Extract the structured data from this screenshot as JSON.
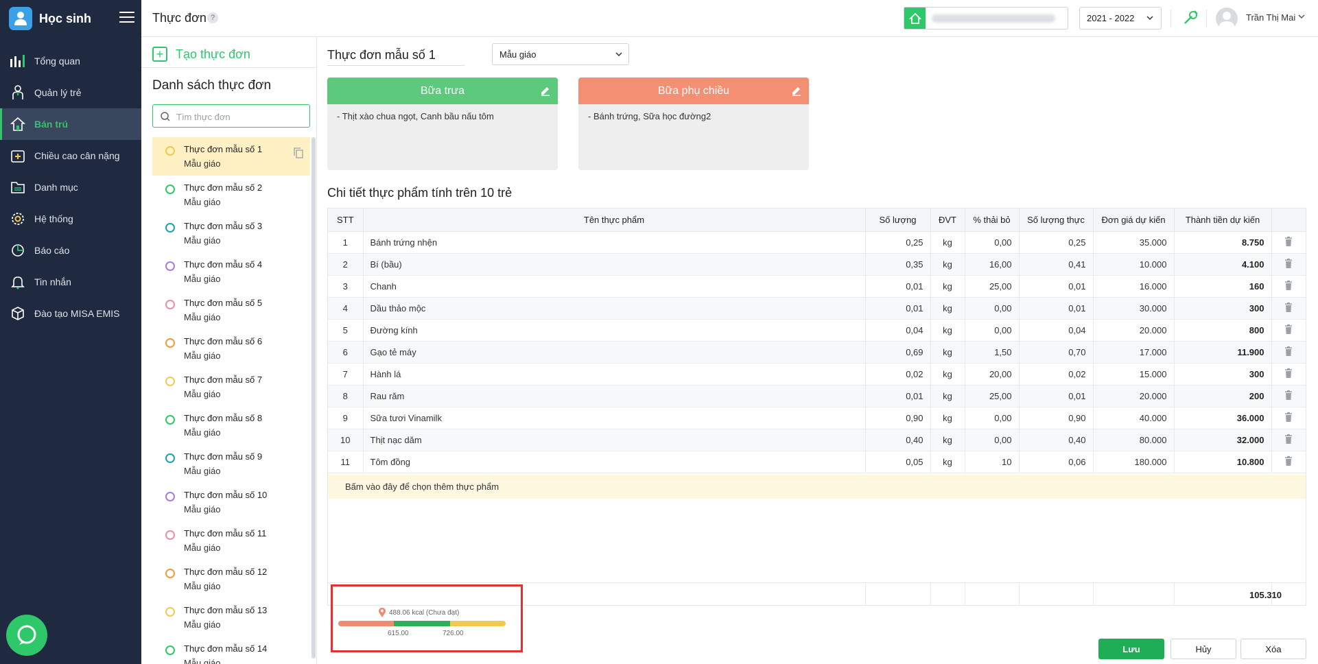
{
  "app": {
    "title": "Học sinh",
    "page_title": "Thực đơn",
    "help": "?"
  },
  "sidebar": {
    "items": [
      {
        "label": "Tổng quan",
        "icon": "chart-icon"
      },
      {
        "label": "Quản lý trẻ",
        "icon": "child-icon"
      },
      {
        "label": "Bán trú",
        "icon": "home-icon"
      },
      {
        "label": "Chiều cao cân nặng",
        "icon": "medical-icon"
      },
      {
        "label": "Danh mục",
        "icon": "folder-icon"
      },
      {
        "label": "Hệ thống",
        "icon": "gear-icon"
      },
      {
        "label": "Báo cáo",
        "icon": "pie-chart-icon"
      },
      {
        "label": "Tin nhắn",
        "icon": "bell-icon"
      },
      {
        "label": "Đào tạo MISA EMIS",
        "icon": "cube-icon"
      }
    ],
    "active_index": 2
  },
  "topbar": {
    "year": "2021 - 2022",
    "user": "Trần Thị Mai"
  },
  "left": {
    "create_label": "Tạo thực đơn",
    "list_title": "Danh sách thực đơn",
    "search_placeholder": "Tìm thực đơn",
    "menus": [
      {
        "name": "Thực đơn mẫu số 1",
        "sub": "Mẫu giáo",
        "color": "#f2c94c"
      },
      {
        "name": "Thực đơn mẫu số 2",
        "sub": "Mẫu giáo",
        "color": "#2ec86a"
      },
      {
        "name": "Thực đơn mẫu số 3",
        "sub": "Mẫu giáo",
        "color": "#17a7a0"
      },
      {
        "name": "Thực đơn mẫu số 4",
        "sub": "Mẫu giáo",
        "color": "#a57ed8"
      },
      {
        "name": "Thực đơn mẫu số 5",
        "sub": "Mẫu giáo",
        "color": "#f48ca0"
      },
      {
        "name": "Thực đơn mẫu số 6",
        "sub": "Mẫu giáo",
        "color": "#f49a3a"
      },
      {
        "name": "Thực đơn mẫu số 7",
        "sub": "Mẫu giáo",
        "color": "#f2c94c"
      },
      {
        "name": "Thực đơn mẫu số 8",
        "sub": "Mẫu giáo",
        "color": "#2ec86a"
      },
      {
        "name": "Thực đơn mẫu số 9",
        "sub": "Mẫu giáo",
        "color": "#17a7a0"
      },
      {
        "name": "Thực đơn mẫu số 10",
        "sub": "Mẫu giáo",
        "color": "#a57ed8"
      },
      {
        "name": "Thực đơn mẫu số 11",
        "sub": "Mẫu giáo",
        "color": "#f48ca0"
      },
      {
        "name": "Thực đơn mẫu số 12",
        "sub": "Mẫu giáo",
        "color": "#f49a3a"
      },
      {
        "name": "Thực đơn mẫu số 13",
        "sub": "Mẫu giáo",
        "color": "#f2c94c"
      },
      {
        "name": "Thực đơn mẫu số 14",
        "sub": "Mẫu giáo",
        "color": "#2ec86a"
      }
    ]
  },
  "main": {
    "menu_name": "Thực đơn mẫu số 1",
    "age_group": "Mẫu giáo",
    "meals": [
      {
        "title": "Bữa trưa",
        "items": "- Thịt xào chua ngọt, Canh bầu nấu tôm",
        "color": "#5cc97c"
      },
      {
        "title": "Bữa phụ chiều",
        "items": "- Bánh trứng, Sữa học đường2",
        "color": "#f39074"
      }
    ],
    "detail_title": "Chi tiết thực phẩm tính trên 10 trẻ",
    "columns": [
      "STT",
      "Tên thực phẩm",
      "Số lượng",
      "ĐVT",
      "% thải bỏ",
      "Số lượng thực",
      "Đơn giá dự kiến",
      "Thành tiền dự kiến"
    ],
    "rows": [
      [
        "1",
        "Bánh trứng nhện",
        "0,25",
        "kg",
        "0,00",
        "0,25",
        "35.000",
        "8.750"
      ],
      [
        "2",
        "Bí (bầu)",
        "0,35",
        "kg",
        "16,00",
        "0,41",
        "10.000",
        "4.100"
      ],
      [
        "3",
        "Chanh",
        "0,01",
        "kg",
        "25,00",
        "0,01",
        "16.000",
        "160"
      ],
      [
        "4",
        "Dầu thảo mộc",
        "0,01",
        "kg",
        "0,00",
        "0,01",
        "30.000",
        "300"
      ],
      [
        "5",
        "Đường kính",
        "0,04",
        "kg",
        "0,00",
        "0,04",
        "20.000",
        "800"
      ],
      [
        "6",
        "Gạo tẻ máy",
        "0,69",
        "kg",
        "1,50",
        "0,70",
        "17.000",
        "11.900"
      ],
      [
        "7",
        "Hành lá",
        "0,02",
        "kg",
        "20,00",
        "0,02",
        "15.000",
        "300"
      ],
      [
        "8",
        "Rau răm",
        "0,01",
        "kg",
        "25,00",
        "0,01",
        "20.000",
        "200"
      ],
      [
        "9",
        "Sữa tươi Vinamilk",
        "0,90",
        "kg",
        "0,00",
        "0,90",
        "40.000",
        "36.000"
      ],
      [
        "10",
        "Thịt nạc dăm",
        "0,40",
        "kg",
        "0,00",
        "0,40",
        "80.000",
        "32.000"
      ],
      [
        "11",
        "Tôm đồng",
        "0,05",
        "kg",
        "10",
        "0,06",
        "180.000",
        "10.800"
      ]
    ],
    "add_label": "Bấm vào đây để chọn thêm thực phẩm",
    "total": "105.310"
  },
  "kcal": {
    "label": "488.06 kcal (Chưa đạt)",
    "low_tick": "615.00",
    "high_tick": "726.00",
    "segment_fractions": [
      0.33,
      0.34,
      0.33
    ],
    "colors": [
      "#f08a70",
      "#2eae5c",
      "#f2c94c"
    ]
  },
  "actions": {
    "save": "Lưu",
    "cancel": "Hủy",
    "delete": "Xóa"
  }
}
